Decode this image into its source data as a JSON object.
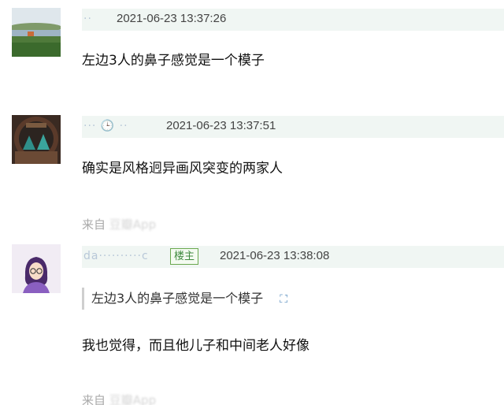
{
  "comments": [
    {
      "user": "··",
      "timestamp": "2021-06-23 13:37:26",
      "text": "左边3人的鼻子感觉是一个模子"
    },
    {
      "user": "··· 🕒  ·· ",
      "timestamp": "2021-06-23 13:37:51",
      "text": "确实是风格迥异画风突变的两家人",
      "source_label": "来自",
      "source_app": "豆瓣App"
    },
    {
      "user": "da··········c",
      "badge": "楼主",
      "timestamp": "2021-06-23 13:38:08",
      "quote": "左边3人的鼻子感觉是一个模子",
      "text": "我也觉得，而且他儿子和中间老人好像",
      "source_label": "来自",
      "source_app": "豆瓣App"
    }
  ],
  "icons": {
    "quote_icon": "expand-quote-icon"
  },
  "colors": {
    "meta_bar": "#f0f6f3",
    "badge_green": "#3f8a3f",
    "quote_border": "#cfcfcf"
  }
}
